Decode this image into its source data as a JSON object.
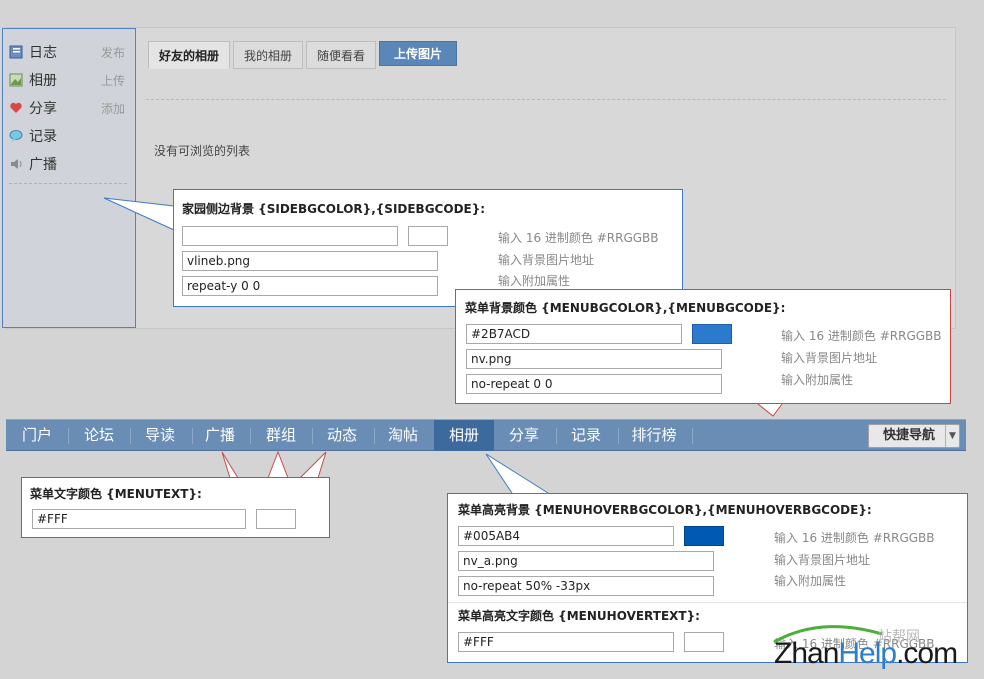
{
  "sidebar": {
    "items": [
      {
        "label": "日志",
        "action": "发布",
        "icon": "journal-icon"
      },
      {
        "label": "相册",
        "action": "上传",
        "icon": "photo-icon"
      },
      {
        "label": "分享",
        "action": "添加",
        "icon": "heart-icon"
      },
      {
        "label": "记录",
        "action": "",
        "icon": "speech-bubble-icon"
      },
      {
        "label": "广播",
        "action": "",
        "icon": "broadcast-icon"
      }
    ]
  },
  "tabs": [
    "好友的相册",
    "我的相册",
    "随便看看"
  ],
  "upload_button": "上传图片",
  "empty_message": "没有可浏览的列表",
  "menu": {
    "items": [
      "门户",
      "论坛",
      "导读",
      "广播",
      "群组",
      "动态",
      "淘帖",
      "相册",
      "分享",
      "记录",
      "排行榜"
    ],
    "active_index": 7,
    "quick_nav": "快捷导航"
  },
  "callouts": {
    "sidebar_bg": {
      "title": "家园侧边背景 {SIDEBGCOLOR},{SIDEBGCODE}:",
      "color_value": "",
      "image_value": "vlineb.png",
      "extra_value": "repeat-y 0 0",
      "hint_color": "输入 16 进制颜色 #RRGGBB",
      "hint_image": "输入背景图片地址",
      "hint_extra": "输入附加属性"
    },
    "menu_bg": {
      "title": "菜单背景颜色 {MENUBGCOLOR},{MENUBGCODE}:",
      "color_value": "#2B7ACD",
      "swatch": "#2B7ACD",
      "image_value": "nv.png",
      "extra_value": "no-repeat 0 0",
      "hint_color": "输入 16 进制颜色 #RRGGBB",
      "hint_image": "输入背景图片地址",
      "hint_extra": "输入附加属性"
    },
    "menu_text": {
      "title": "菜单文字颜色 {MENUTEXT}:",
      "color_value": "#FFF"
    },
    "menu_hover": {
      "title": "菜单高亮背景 {MENUHOVERBGCOLOR},{MENUHOVERBGCODE}:",
      "color_value": "#005AB4",
      "swatch": "#005AB4",
      "image_value": "nv_a.png",
      "extra_value": "no-repeat 50% -33px",
      "hint_color": "输入 16 进制颜色 #RRGGBB",
      "hint_image": "输入背景图片地址",
      "hint_extra": "输入附加属性",
      "text_title": "菜单高亮文字颜色 {MENUHOVERTEXT}:",
      "text_color_value": "#FFF",
      "text_hint": "输入 16 进制颜色 #RRGGBB"
    }
  },
  "watermark": {
    "prefix": "Zhan",
    "brand": "Help",
    "suffix": ".com",
    "top_text": "站帮网"
  }
}
